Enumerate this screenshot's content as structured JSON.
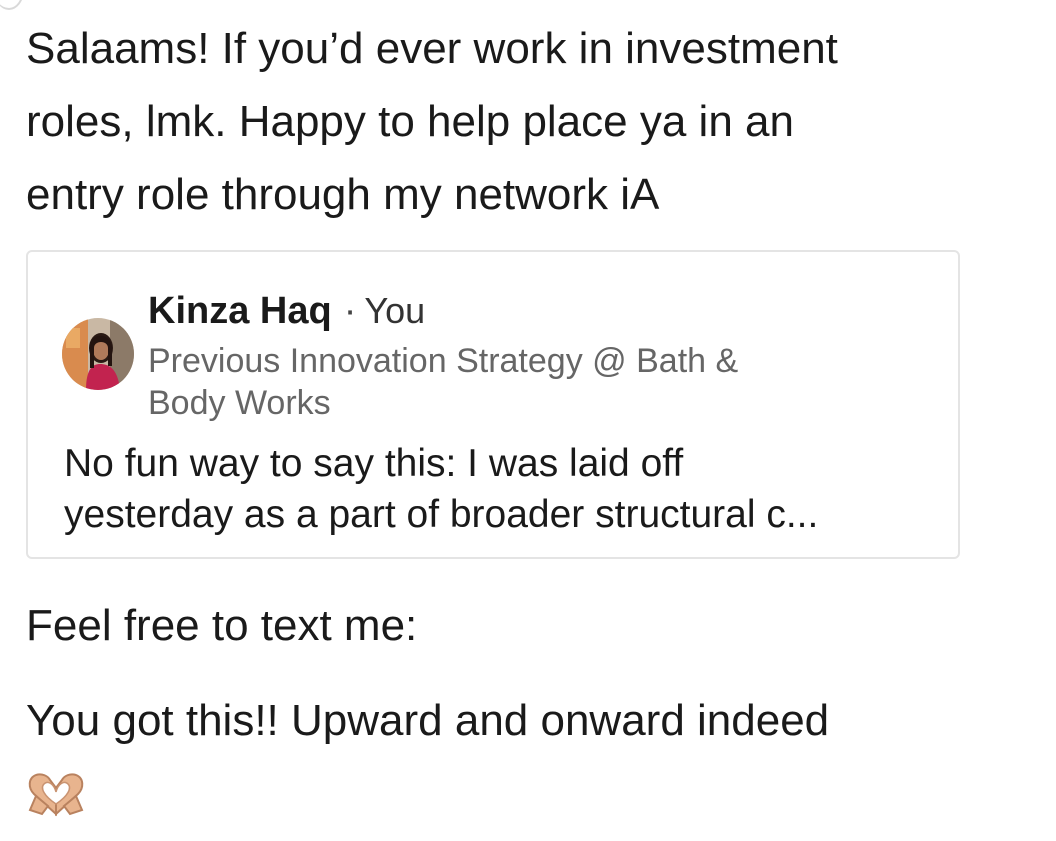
{
  "message": {
    "intro_lines": [
      "Salaams! If you’d ever work in investment",
      "roles, lmk. Happy to help place ya in an",
      "entry role through my network iA"
    ],
    "contact_text": "Feel free to text me:",
    "encouragement": "You got this!! Upward and onward indeed"
  },
  "shared_post": {
    "author_name": "Kinza Haq",
    "separator": "·",
    "author_relation": "You",
    "headline_lines": [
      "Previous Innovation Strategy @ Bath &",
      "Body Works"
    ],
    "excerpt_lines": [
      "No fun way to say this: I was laid off",
      "yesterday as a part of broader structural c..."
    ]
  },
  "icons": {
    "avatar": "profile-photo",
    "emoji": "heart-hands-icon"
  },
  "colors": {
    "text_primary": "#1a1a1a",
    "text_secondary": "#666666",
    "card_border": "#e4e4e4",
    "emoji_skin": "#e8b48e"
  }
}
